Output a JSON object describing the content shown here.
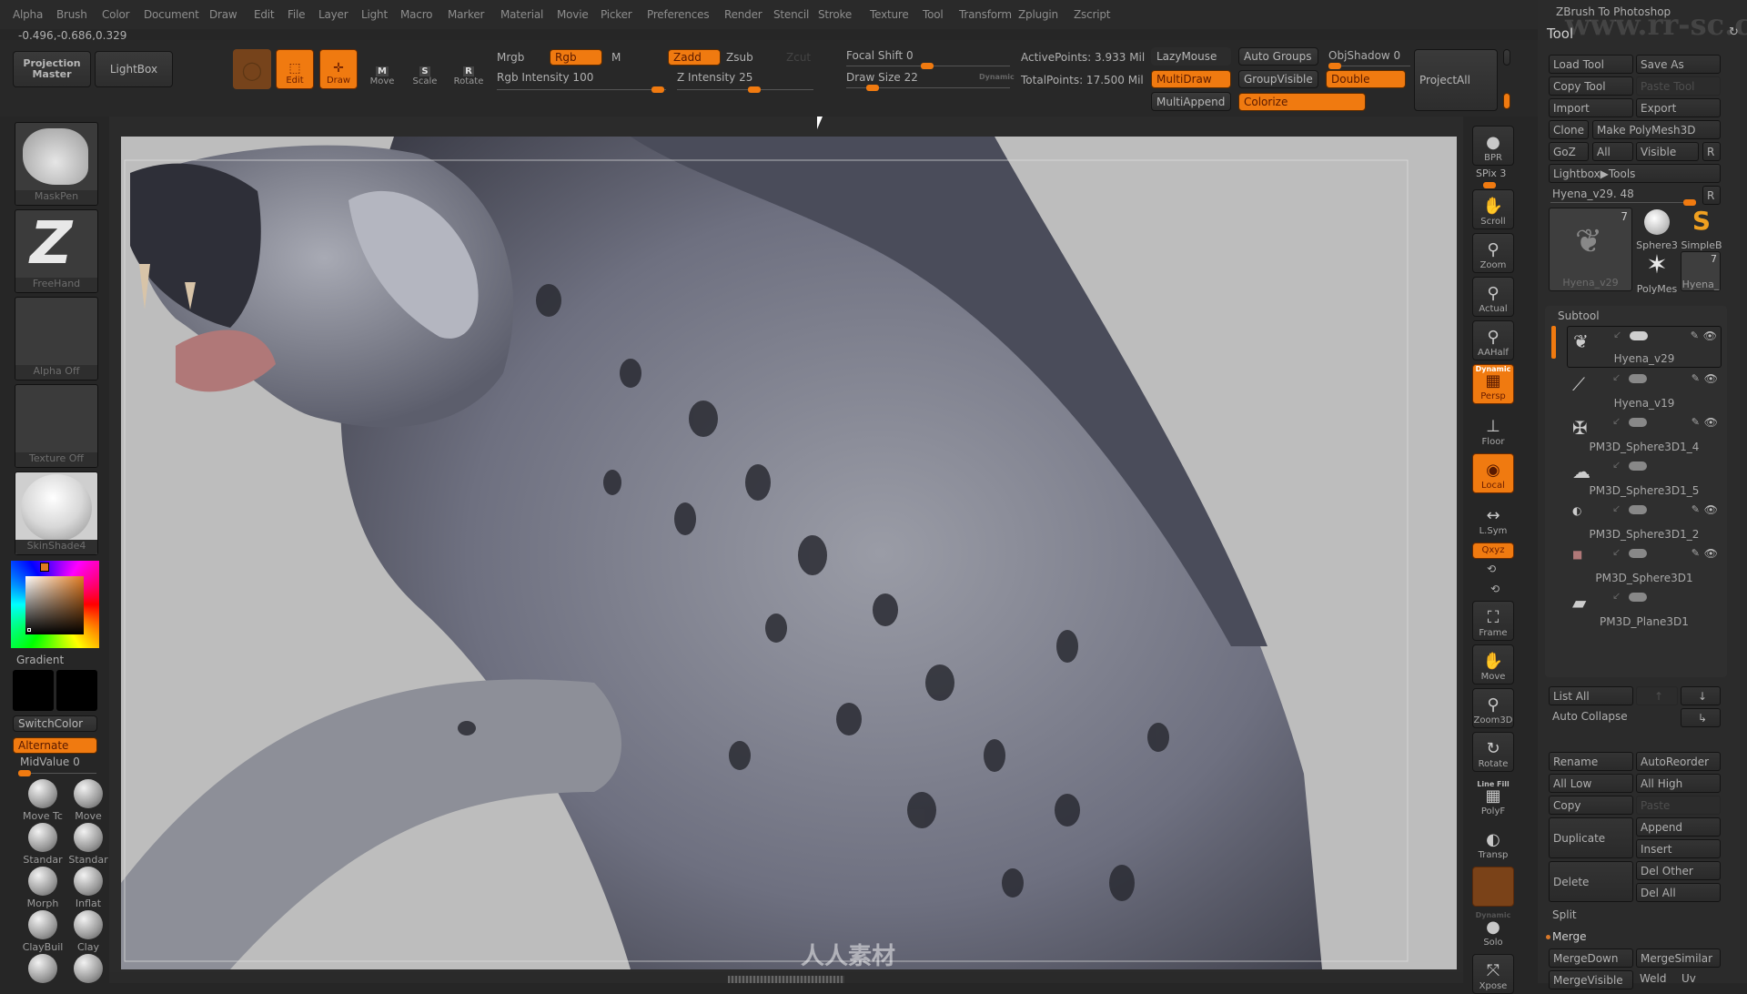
{
  "menu": [
    "Alpha",
    "Brush",
    "Color",
    "Document",
    "Draw",
    "Edit",
    "File",
    "Layer",
    "Light",
    "Macro",
    "Marker",
    "Material",
    "Movie",
    "Picker",
    "Preferences",
    "Render",
    "Stencil",
    "Stroke",
    "Texture",
    "Tool",
    "Transform",
    "Zplugin",
    "Zscript"
  ],
  "coords": "-0.496,-0.686,0.329",
  "shelf": {
    "projection_master": "Projection Master",
    "lightbox": "LightBox",
    "edit": "Edit",
    "draw": "Draw",
    "move": "Move",
    "scale": "Scale",
    "rotate": "Rotate",
    "move_key": "M",
    "scale_key": "S",
    "rotate_key": "R",
    "mrgb": "Mrgb",
    "rgb": "Rgb",
    "m": "M",
    "zadd": "Zadd",
    "zsub": "Zsub",
    "zcut": "Zcut",
    "rgb_intensity": "Rgb Intensity 100",
    "z_intensity": "Z Intensity 25",
    "focal_shift": "Focal Shift 0",
    "draw_size": "Draw Size 22",
    "dynamic": "Dynamic",
    "active_points": "ActivePoints: 3.933 Mil",
    "total_points": "TotalPoints: 17.500 Mil",
    "lazymouse": "LazyMouse",
    "multidraw": "MultiDraw",
    "multiappend": "MultiAppend",
    "auto_groups": "Auto Groups",
    "group_visible": "GroupVisible",
    "colorize": "Colorize",
    "objshadow": "ObjShadow 0",
    "double": "Double",
    "projectall": "ProjectAll",
    "rgb_intensity_value": 100,
    "z_intensity_value": 25,
    "focal_shift_value": 0,
    "draw_size_value": 22
  },
  "left": {
    "brush": "MaskPen",
    "stroke": "FreeHand",
    "alpha": "Alpha Off",
    "texture": "Texture Off",
    "material": "SkinShade4",
    "gradient": "Gradient",
    "switchcolor": "SwitchColor",
    "alternate": "Alternate",
    "midvalue": "MidValue 0",
    "brushes": [
      "Move Tc",
      "Move",
      "Standar",
      "Standar",
      "Morph",
      "Inflat",
      "ClayBuil",
      "Clay"
    ],
    "main_color": "#e07a20"
  },
  "rshelf": {
    "bpr": "BPR",
    "spix": "SPix 3",
    "scroll": "Scroll",
    "zoom": "Zoom",
    "actual": "Actual",
    "aahalf": "AAHalf",
    "dynamic": "Dynamic",
    "persp": "Persp",
    "floor": "Floor",
    "local": "Local",
    "lsym": "L.Sym",
    "xyz": "Qxyz",
    "frame": "Frame",
    "move": "Move",
    "zoom3d": "Zoom3D",
    "rotate": "Rotate",
    "linefill": "Line Fill",
    "polyf": "PolyF",
    "transp": "Transp",
    "dynamic2": "Dynamic",
    "solo": "Solo",
    "xpose": "Xpose"
  },
  "rpanel": {
    "plugin_title": "ZBrush To Photoshop",
    "tool_title": "Tool",
    "load_tool": "Load Tool",
    "save_as": "Save As",
    "copy_tool": "Copy Tool",
    "paste_tool": "Paste Tool",
    "import": "Import",
    "export": "Export",
    "clone": "Clone",
    "make_polymesh": "Make PolyMesh3D",
    "goz": "GoZ",
    "all": "All",
    "visible": "Visible",
    "r": "R",
    "lightbox_tools": "Lightbox▶Tools",
    "current_tool": "Hyena_v29. 48",
    "tool_thumbs": [
      {
        "name": "Hyena_v29",
        "count": "7"
      },
      {
        "name": "Sphere3"
      },
      {
        "name": "SimpleB"
      },
      {
        "name": "PolyMes"
      },
      {
        "name": "Hyena_",
        "count": "7"
      }
    ],
    "subtool_title": "Subtool",
    "subtools": [
      "Hyena_v29",
      "Hyena_v19",
      "PM3D_Sphere3D1_4",
      "PM3D_Sphere3D1_5",
      "PM3D_Sphere3D1_2",
      "PM3D_Sphere3D1",
      "PM3D_Plane3D1"
    ],
    "list_all": "List All",
    "auto_collapse": "Auto Collapse",
    "rename": "Rename",
    "autoreorder": "AutoReorder",
    "all_low": "All Low",
    "all_high": "All High",
    "copy": "Copy",
    "paste": "Paste",
    "duplicate": "Duplicate",
    "append": "Append",
    "insert": "Insert",
    "delete": "Delete",
    "del_other": "Del Other",
    "del_all": "Del All",
    "split": "Split",
    "merge": "Merge",
    "mergedown": "MergeDown",
    "mergesimilar": "MergeSimilar",
    "mergevisible": "MergeVisible",
    "weld": "Weld",
    "uv": "Uv"
  },
  "watermark": {
    "url": "www.rr-sc.com",
    "brand": "人人素材"
  }
}
